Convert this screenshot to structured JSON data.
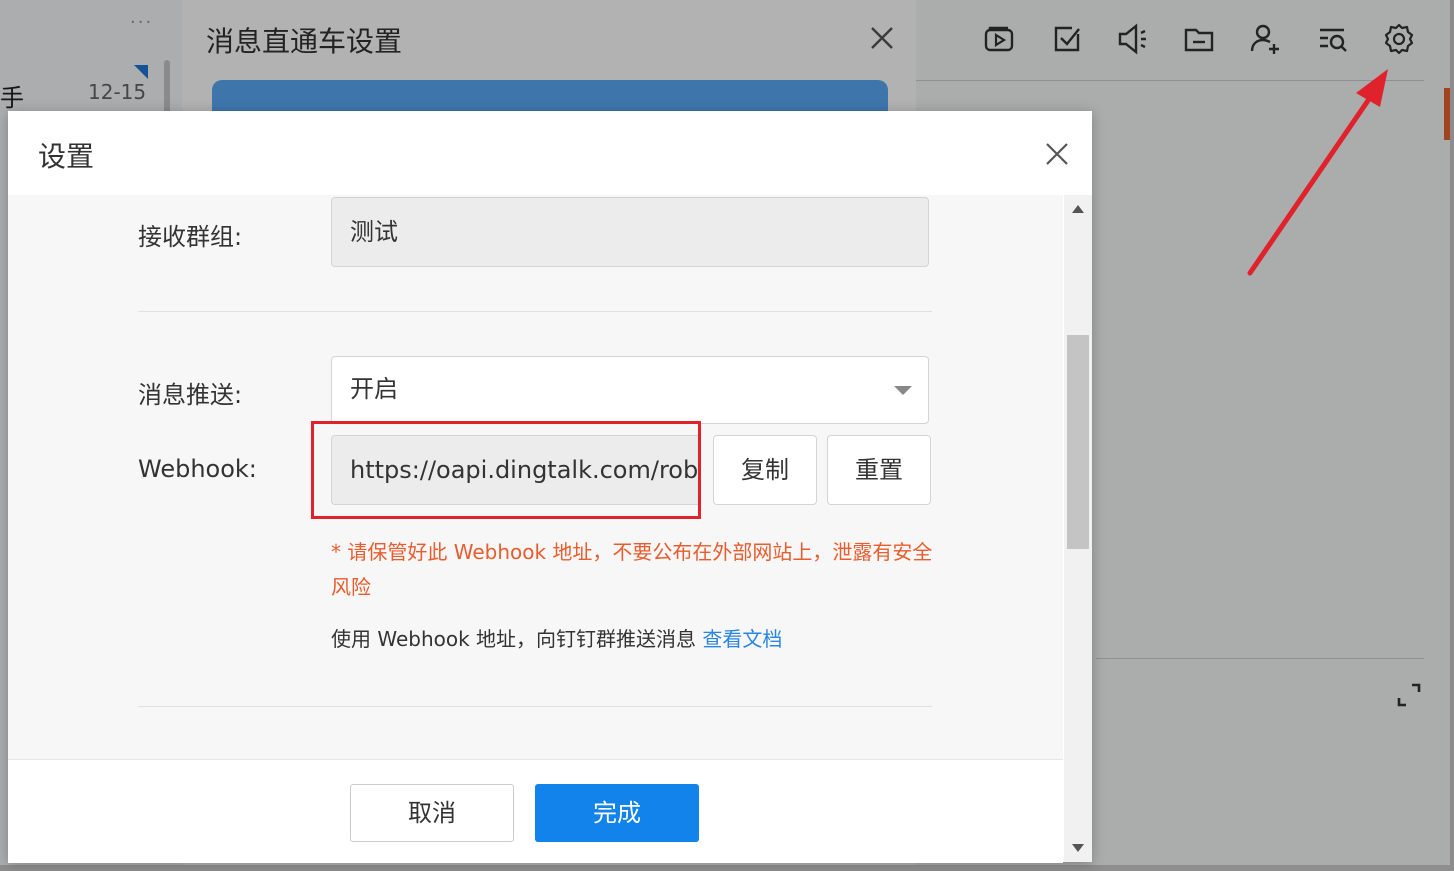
{
  "background_app": {
    "more_label": "···",
    "list_item_name": "手",
    "list_item_date": "12-15"
  },
  "parent_dialog": {
    "title": "消息直通车设置"
  },
  "toolbar_icons": [
    "video-icon",
    "checkbox-icon",
    "speaker-icon",
    "folder-icon",
    "add-user-icon",
    "search-list-icon",
    "gear-icon"
  ],
  "dialog": {
    "title": "设置",
    "receive_group": {
      "label": "接收群组:",
      "value": "测试"
    },
    "push": {
      "label": "消息推送:",
      "value": "开启"
    },
    "webhook": {
      "label": "Webhook:",
      "value": "https://oapi.dingtalk.com/robot/send?access_token=",
      "copy_label": "复制",
      "reset_label": "重置"
    },
    "warning": "* 请保管好此 Webhook 地址，不要公布在外部网站上，泄露有安全风险",
    "hint_text": "使用 Webhook 地址，向钉钉群推送消息 ",
    "hint_link": "查看文档",
    "cancel_label": "取消",
    "ok_label": "完成"
  },
  "colors": {
    "primary": "#1183ea",
    "warning": "#e85c2d",
    "annotation": "#e0222c",
    "link": "#2a86e0"
  }
}
